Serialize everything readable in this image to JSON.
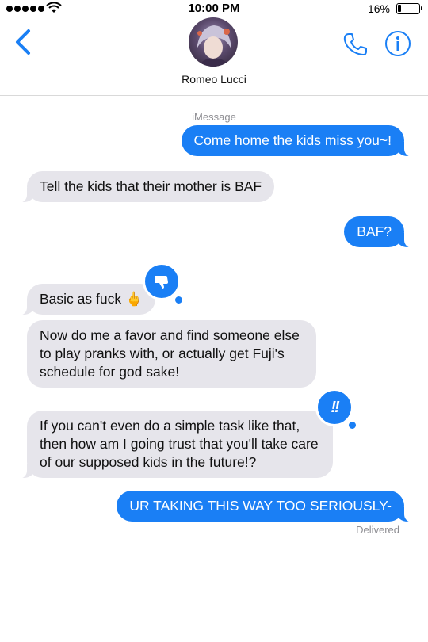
{
  "status_bar": {
    "time": "10:00 PM",
    "battery": "16%"
  },
  "header": {
    "contact_name": "Romeo Lucci",
    "back_icon": "chevron-left-icon",
    "call_icon": "phone-icon",
    "info_icon": "info-icon"
  },
  "thread": {
    "service_label": "iMessage",
    "messages": [
      {
        "side": "out",
        "text": "Come home the kids miss you~!"
      },
      {
        "side": "in",
        "text": "Tell the kids that their mother is BAF"
      },
      {
        "side": "out",
        "text": "BAF?"
      },
      {
        "side": "in",
        "text": "Basic as fuck 🖕",
        "tapback": "thumbs-down-icon"
      },
      {
        "side": "in",
        "text": "Now do me a favor and find someone else to play pranks with, or actually get Fuji's schedule for god sake!"
      },
      {
        "side": "in",
        "text": "If you can't even do a simple task like that, then how am I going trust that you'll take care of our supposed kids in the future!?",
        "tapback": "exclamation-icon",
        "tapback_text": "!!"
      },
      {
        "side": "out",
        "text": "UR TAKING THIS WAY TOO SERIOUSLY-"
      }
    ],
    "delivery_status": "Delivered"
  },
  "colors": {
    "outgoing": "#1a7ff5",
    "incoming": "#e6e5eb",
    "accent": "#1a7ff5"
  }
}
